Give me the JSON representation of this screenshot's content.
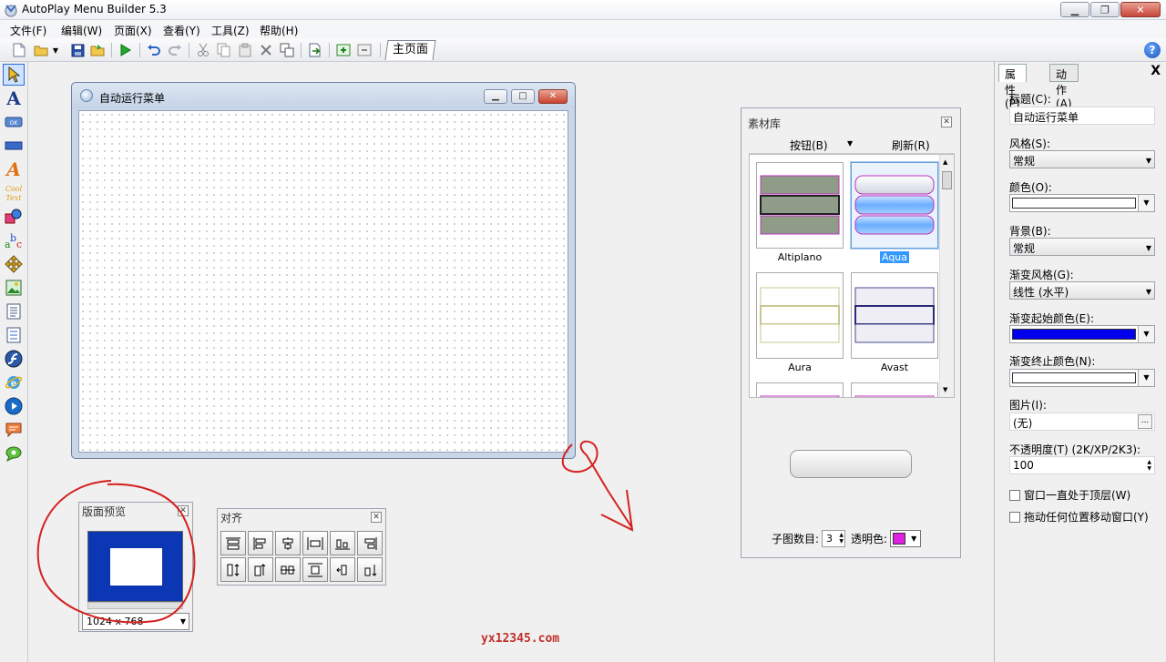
{
  "window": {
    "title": "AutoPlay Menu Builder 5.3"
  },
  "menubar": [
    {
      "label": "文件(F)"
    },
    {
      "label": "编辑(W)"
    },
    {
      "label": "页面(X)"
    },
    {
      "label": "查看(Y)"
    },
    {
      "label": "工具(Z)"
    },
    {
      "label": "帮助(H)"
    }
  ],
  "toolbar": {
    "page_tab": "主页面",
    "help": "?"
  },
  "designer": {
    "title": "自动运行菜单"
  },
  "preview": {
    "title": "版面预览",
    "resolution": "1024 x 768"
  },
  "align": {
    "title": "对齐"
  },
  "library": {
    "title": "素材库",
    "tab_buttons": "按钮(B)",
    "tab_refresh": "刷新(R)",
    "skins": [
      {
        "name": "Altiplano"
      },
      {
        "name": "Aqua"
      },
      {
        "name": "Aura"
      },
      {
        "name": "Avast"
      }
    ],
    "subimage_label": "子图数目:",
    "subimage_value": "3",
    "transparent_label": "透明色:",
    "transparent_color": "#e020e0"
  },
  "properties": {
    "tab_props": "属性(P)",
    "tab_actions": "动作(A)",
    "close": "X",
    "title_label": "标题(C):",
    "title_value": "自动运行菜单",
    "style_label": "风格(S):",
    "style_value": "常规",
    "color_label": "颜色(O):",
    "color_value": "#ffffff",
    "background_label": "背景(B):",
    "background_value": "常规",
    "gradient_style_label": "渐变风格(G):",
    "gradient_style_value": "线性 (水平)",
    "gradient_start_label": "渐变起始颜色(E):",
    "gradient_start_value": "#0000ee",
    "gradient_end_label": "渐变终止颜色(N):",
    "gradient_end_value": "#ffffff",
    "image_label": "图片(I):",
    "image_value": "(无)",
    "image_button": "...",
    "opacity_label": "不透明度(T) (2K/XP/2K3):",
    "opacity_value": "100",
    "always_on_top_label": "窗口一直处于顶层(W)",
    "drag_move_label": "拖动任何位置移动窗口(Y)"
  },
  "watermark": "yx12345.com"
}
